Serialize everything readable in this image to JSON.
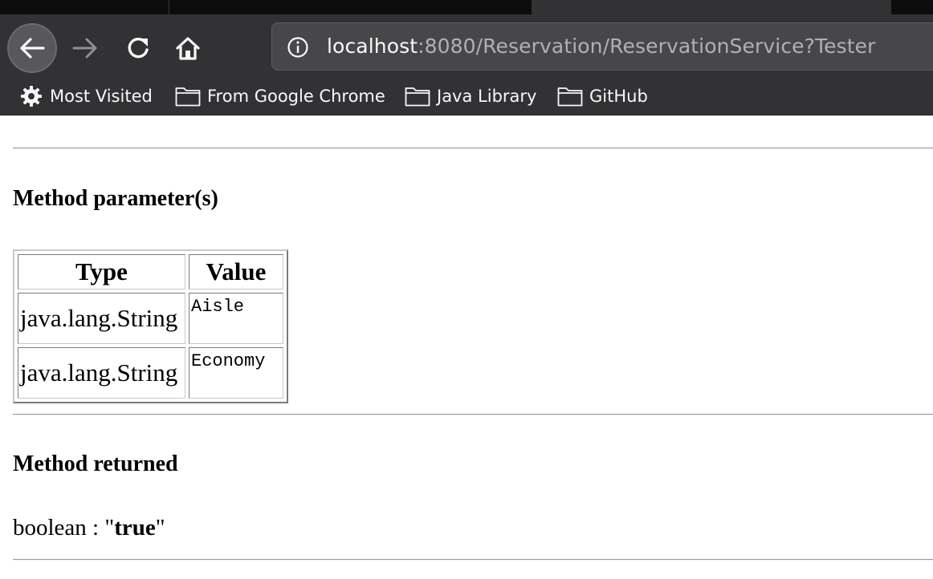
{
  "browser": {
    "url_host": "localhost",
    "url_rest": ":8080/Reservation/ReservationService?Tester",
    "bookmarks": [
      {
        "label": "Most Visited",
        "icon": "gear-icon"
      },
      {
        "label": "From Google Chrome",
        "icon": "folder-icon"
      },
      {
        "label": "Java Library",
        "icon": "folder-icon"
      },
      {
        "label": "GitHub",
        "icon": "folder-icon"
      }
    ]
  },
  "page": {
    "params_heading": "Method parameter(s)",
    "table": {
      "headers": [
        "Type",
        "Value"
      ],
      "rows": [
        {
          "type": "java.lang.String",
          "value": "Aisle"
        },
        {
          "type": "java.lang.String",
          "value": "Economy"
        }
      ]
    },
    "returned_heading": "Method returned",
    "result": {
      "prefix": "boolean : \"",
      "value": "true",
      "suffix": "\""
    }
  }
}
